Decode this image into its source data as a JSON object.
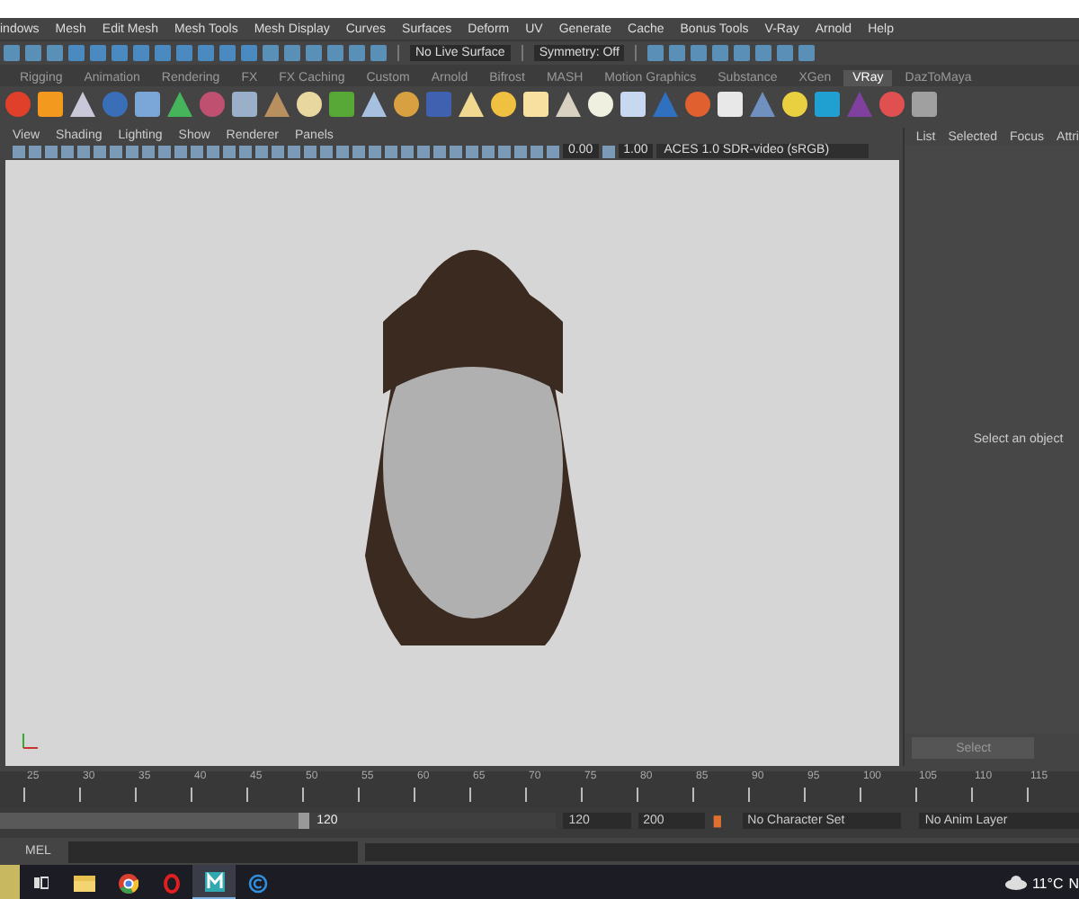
{
  "menu_bar": [
    "indows",
    "Mesh",
    "Edit Mesh",
    "Mesh Tools",
    "Mesh Display",
    "Curves",
    "Surfaces",
    "Deform",
    "UV",
    "Generate",
    "Cache",
    "Bonus Tools",
    "V-Ray",
    "Arnold",
    "Help"
  ],
  "status_line": {
    "live_surface": "No Live Surface",
    "symmetry": "Symmetry: Off"
  },
  "shelf": {
    "tabs": [
      {
        "label": "Rigging",
        "selected": false
      },
      {
        "label": "Animation",
        "selected": false
      },
      {
        "label": "Rendering",
        "selected": false
      },
      {
        "label": "FX",
        "selected": false
      },
      {
        "label": "FX Caching",
        "selected": false
      },
      {
        "label": "Custom",
        "selected": false
      },
      {
        "label": "Arnold",
        "selected": false
      },
      {
        "label": "Bifrost",
        "selected": false
      },
      {
        "label": "MASH",
        "selected": false
      },
      {
        "label": "Motion Graphics",
        "selected": false
      },
      {
        "label": "Substance",
        "selected": false
      },
      {
        "label": "XGen",
        "selected": false
      },
      {
        "label": "VRay",
        "selected": true
      },
      {
        "label": "DazToMaya",
        "selected": false
      }
    ]
  },
  "viewport": {
    "menu": [
      "View",
      "Shading",
      "Lighting",
      "Show",
      "Renderer",
      "Panels"
    ],
    "exposure": "0.00",
    "gamma": "1.00",
    "color_space": "ACES 1.0 SDR-video (sRGB)"
  },
  "side_panel": {
    "tabs": [
      "List",
      "Selected",
      "Focus",
      "Attri"
    ],
    "message": "Select an object",
    "button": "Select"
  },
  "time_slider": {
    "ticks": [
      "25",
      "30",
      "35",
      "40",
      "45",
      "50",
      "55",
      "60",
      "65",
      "70",
      "75",
      "80",
      "85",
      "90",
      "95",
      "100",
      "105",
      "110",
      "115"
    ]
  },
  "range_slider": {
    "level": 0.56,
    "end_handle": "120",
    "playback_end": "120",
    "animation_end": "200",
    "character_set": "No Character Set",
    "anim_layer": "No Anim Layer"
  },
  "command_line": {
    "label": "MEL"
  },
  "taskbar": {
    "apps": [
      {
        "kind": "taskview",
        "selected": false
      },
      {
        "kind": "folder",
        "selected": false
      },
      {
        "kind": "chrome",
        "selected": false
      },
      {
        "kind": "opera",
        "selected": false
      },
      {
        "kind": "maya",
        "selected": true
      },
      {
        "kind": "circle-c",
        "selected": false
      }
    ],
    "temperature": "11°C",
    "clock": "N"
  }
}
